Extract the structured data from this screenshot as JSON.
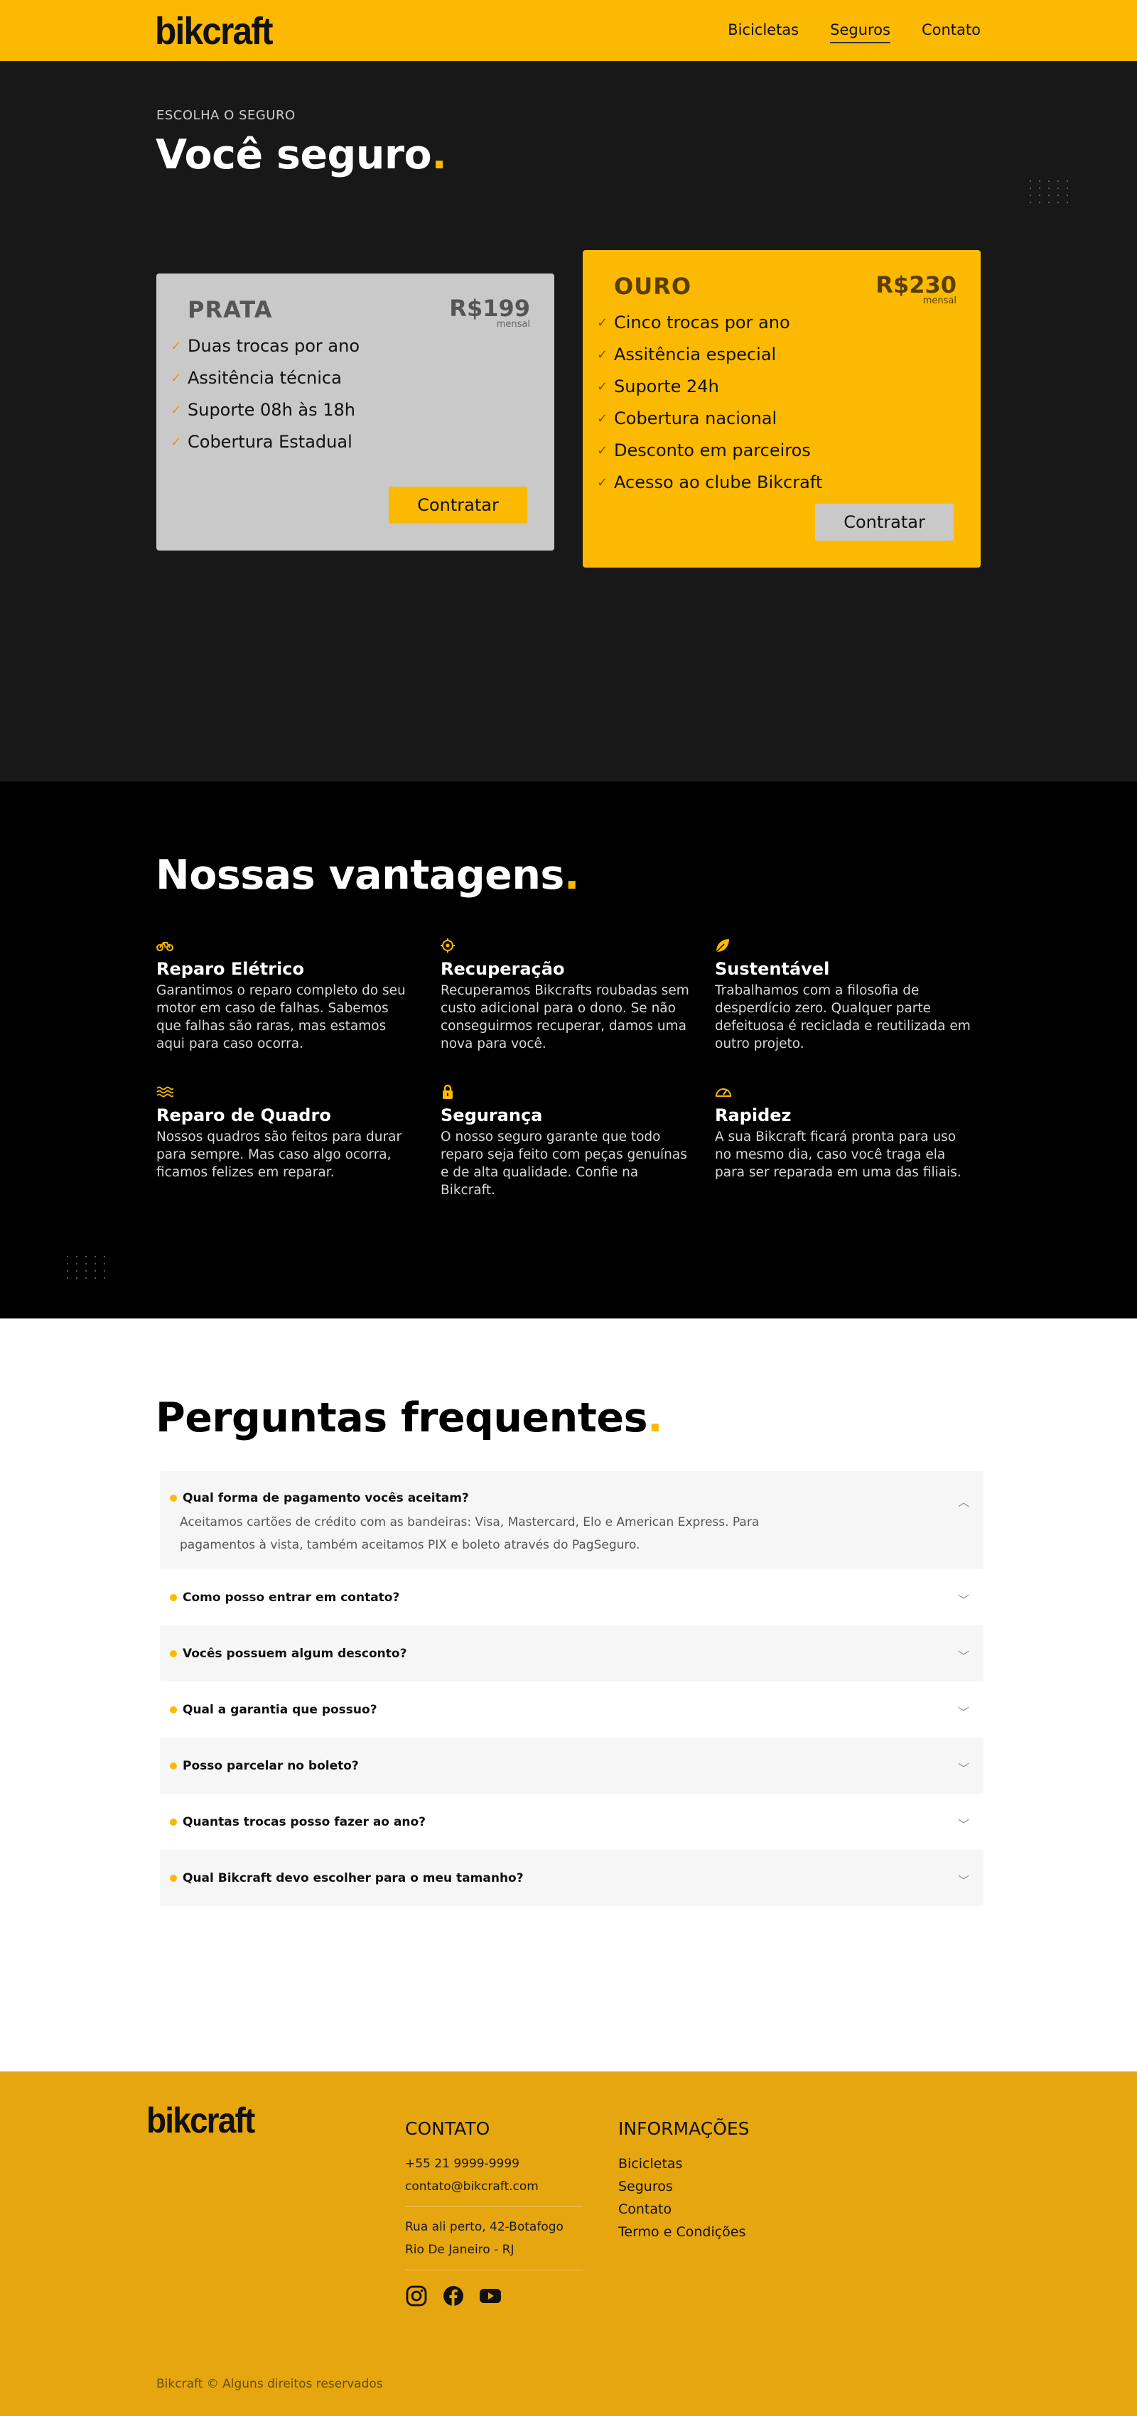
{
  "header": {
    "logo": "bikcraft",
    "nav": [
      {
        "label": "Bicicletas"
      },
      {
        "label": "Seguros"
      },
      {
        "label": "Contato"
      }
    ]
  },
  "hero": {
    "eyebrow": "ESCOLHA O SEGURO",
    "title": "Você seguro",
    "title_dot": "."
  },
  "plans": [
    {
      "name": "PRATA",
      "price": "R$199",
      "period": "mensal",
      "features": [
        "Duas trocas por ano",
        "Assitência técnica",
        "Suporte 08h às 18h",
        "Cobertura Estadual"
      ],
      "button": "Contratar"
    },
    {
      "name": "OURO",
      "price": "R$230",
      "period": "mensal",
      "features": [
        "Cinco trocas por ano",
        "Assitência especial",
        "Suporte 24h",
        "Cobertura nacional",
        "Desconto em parceiros",
        "Acesso ao clube Bikcraft"
      ],
      "button": "Contratar"
    }
  ],
  "vantagens": {
    "title": "Nossas vantagens",
    "title_dot": ".",
    "items": [
      {
        "icon": "bicycle-icon",
        "title": "Reparo Elétrico",
        "text": "Garantimos o reparo completo do seu motor em caso de falhas. Sabemos que falhas são raras, mas estamos aqui para caso ocorra."
      },
      {
        "icon": "target-icon",
        "title": "Recuperação",
        "text": "Recuperamos Bikcrafts roubadas sem custo adicional para o dono. Se não conseguirmos recuperar, damos uma nova para você."
      },
      {
        "icon": "leaf-icon",
        "title": "Sustentável",
        "text": "Trabalhamos com a filosofia de desperdício zero. Qualquer parte defeituosa é reciclada e reutilizada em outro projeto."
      },
      {
        "icon": "waves-icon",
        "title": "Reparo de Quadro",
        "text": "Nossos quadros são feitos para durar para sempre. Mas caso algo ocorra, ficamos felizes em reparar."
      },
      {
        "icon": "lock-icon",
        "title": "Segurança",
        "text": "O nosso seguro garante que todo reparo seja feito com peças genuínas e de alta qualidade. Confie na Bikcraft."
      },
      {
        "icon": "speedometer-icon",
        "title": "Rapidez",
        "text": "A sua Bikcraft ficará pronta para uso no mesmo dia, caso você traga ela para ser reparada em uma das filiais."
      }
    ]
  },
  "faq": {
    "title": "Perguntas frequentes",
    "title_dot": ".",
    "items": [
      {
        "q": "Qual forma de pagamento vocês aceitam?",
        "a": "Aceitamos cartões de crédito com as bandeiras: Visa, Mastercard, Elo e American Express. Para pagamentos à vista, também aceitamos PIX e boleto através do PagSeguro."
      },
      {
        "q": "Como posso entrar em contato?"
      },
      {
        "q": "Vocês possuem algum desconto?"
      },
      {
        "q": "Qual a garantia que possuo?"
      },
      {
        "q": "Posso parcelar no boleto?"
      },
      {
        "q": "Quantas trocas posso fazer ao ano?"
      },
      {
        "q": "Qual Bikcraft devo escolher para o meu tamanho?"
      }
    ]
  },
  "footer": {
    "logo": "bikcraft",
    "contato": {
      "title": "CONTATO",
      "phone": "+55 21 9999-9999",
      "email": "contato@bikcraft.com",
      "address1": "Rua ali perto, 42-Botafogo",
      "address2": "Rio De Janeiro - RJ",
      "socials": [
        "instagram-icon",
        "facebook-icon",
        "youtube-icon"
      ]
    },
    "info": {
      "title": "INFORMAÇÕES",
      "links": [
        "Bicicletas",
        "Seguros",
        "Contato",
        "Termo e Condições"
      ]
    },
    "copyright": "Bikcraft © Alguns direitos reservados"
  },
  "colors": {
    "accent": "#fbb901",
    "dark": "#181818",
    "black": "#000000",
    "footer": "#e6a60f"
  }
}
